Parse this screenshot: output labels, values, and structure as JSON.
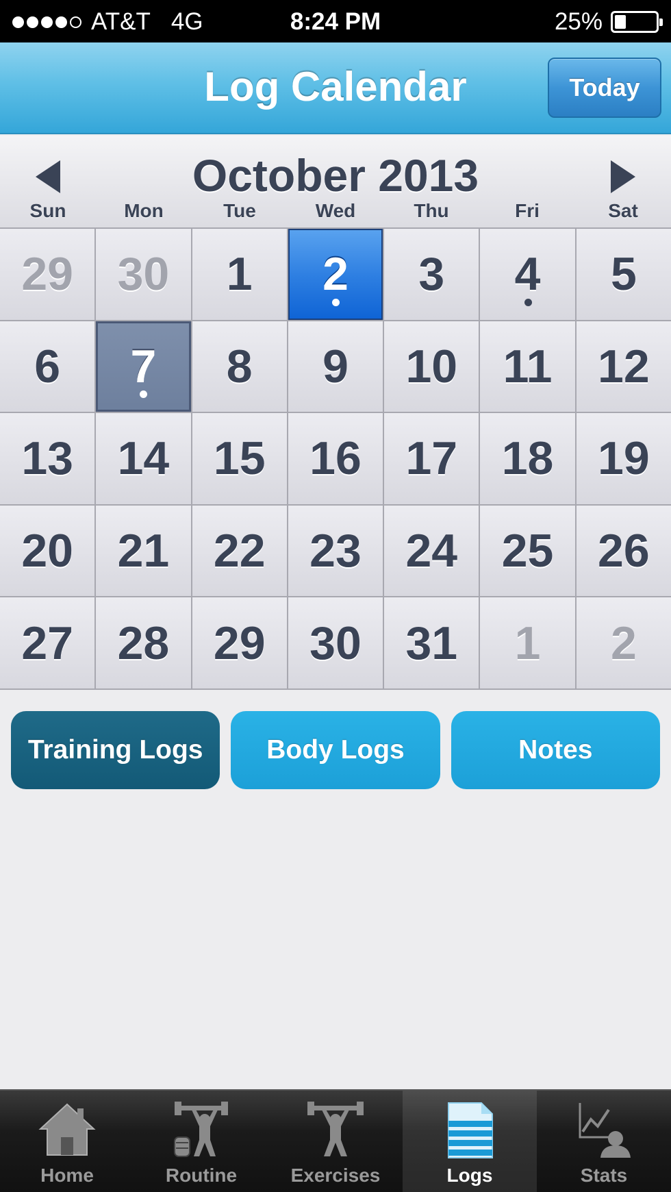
{
  "status_bar": {
    "carrier": "AT&T",
    "network": "4G",
    "time": "8:24 PM",
    "battery": "25%",
    "battery_level": 0.25,
    "signal_bars": 4
  },
  "nav": {
    "title": "Log Calendar",
    "today_label": "Today"
  },
  "calendar": {
    "month_label": "October 2013",
    "weekdays": [
      "Sun",
      "Mon",
      "Tue",
      "Wed",
      "Thu",
      "Fri",
      "Sat"
    ],
    "days": [
      {
        "label": "29",
        "other": true
      },
      {
        "label": "30",
        "other": true
      },
      {
        "label": "1"
      },
      {
        "label": "2",
        "selected": true,
        "marker": true
      },
      {
        "label": "3"
      },
      {
        "label": "4",
        "marker": true
      },
      {
        "label": "5"
      },
      {
        "label": "6"
      },
      {
        "label": "7",
        "today": true,
        "marker": true
      },
      {
        "label": "8"
      },
      {
        "label": "9"
      },
      {
        "label": "10"
      },
      {
        "label": "11"
      },
      {
        "label": "12"
      },
      {
        "label": "13"
      },
      {
        "label": "14"
      },
      {
        "label": "15"
      },
      {
        "label": "16"
      },
      {
        "label": "17"
      },
      {
        "label": "18"
      },
      {
        "label": "19"
      },
      {
        "label": "20"
      },
      {
        "label": "21"
      },
      {
        "label": "22"
      },
      {
        "label": "23"
      },
      {
        "label": "24"
      },
      {
        "label": "25"
      },
      {
        "label": "26"
      },
      {
        "label": "27"
      },
      {
        "label": "28"
      },
      {
        "label": "29"
      },
      {
        "label": "30"
      },
      {
        "label": "31"
      },
      {
        "label": "1",
        "other": true
      },
      {
        "label": "2",
        "other": true
      }
    ]
  },
  "segments": [
    {
      "label": "Training Logs",
      "active": true
    },
    {
      "label": "Body Logs",
      "active": false
    },
    {
      "label": "Notes",
      "active": false
    }
  ],
  "tabs": [
    {
      "label": "Home",
      "icon": "home-icon",
      "active": false
    },
    {
      "label": "Routine",
      "icon": "routine-icon",
      "active": false
    },
    {
      "label": "Exercises",
      "icon": "exercises-icon",
      "active": false
    },
    {
      "label": "Logs",
      "icon": "logs-icon",
      "active": true
    },
    {
      "label": "Stats",
      "icon": "stats-icon",
      "active": false
    }
  ],
  "colors": {
    "accent": "#34a6d9",
    "selected_day": "#1a6fdc",
    "today_day": "#6d7f9d",
    "segment_active": "#135a77",
    "segment_inactive": "#1ca0d8"
  }
}
